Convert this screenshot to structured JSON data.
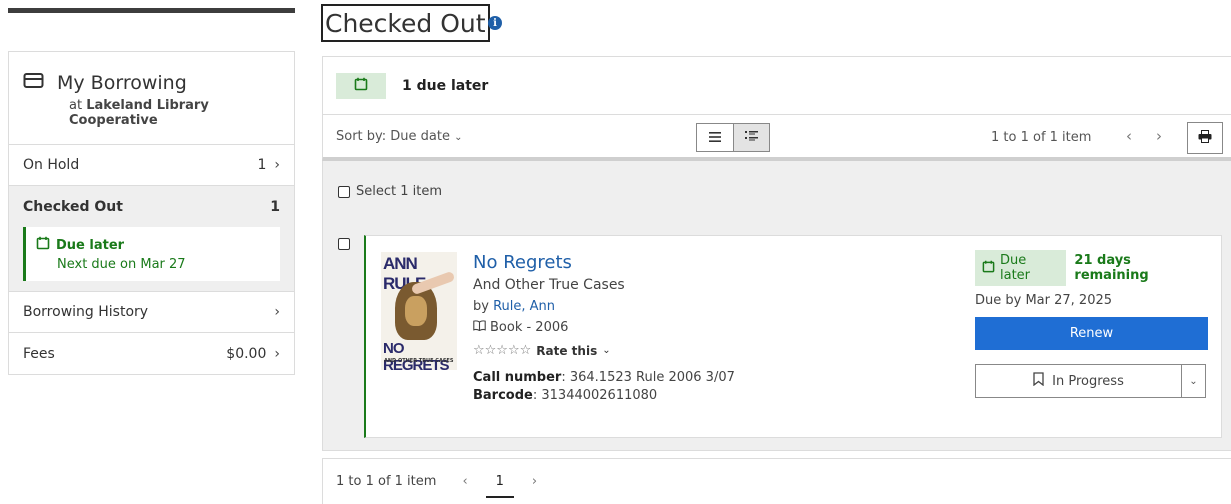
{
  "sidebar": {
    "title": "My Borrowing",
    "at_label": "at",
    "library": "Lakeland Library Cooperative",
    "items": [
      {
        "label": "On Hold",
        "count": "1"
      },
      {
        "label": "Checked Out",
        "count": "1"
      },
      {
        "label": "Borrowing History",
        "count": ""
      },
      {
        "label": "Fees",
        "count": "$0.00"
      }
    ],
    "due_later": {
      "title": "Due later",
      "next": "Next due on Mar 27"
    }
  },
  "page": {
    "title": "Checked Out",
    "info_icon": "i"
  },
  "summary": {
    "due_later_count": "1 due later"
  },
  "toolbar": {
    "sort_label": "Sort by: Due date",
    "range": "1 to 1 of 1 item"
  },
  "list": {
    "select_label": "Select 1 item",
    "items": [
      {
        "title": "No Regrets",
        "subtitle": "And Other True Cases",
        "by": "by",
        "author": "Rule, Ann",
        "format": "Book - 2006",
        "rate_label": "Rate this",
        "call_label": "Call number",
        "call_number": "364.1523 Rule 2006 3/07",
        "barcode_label": "Barcode",
        "barcode": "31344002611080",
        "due_chip": "Due later",
        "remaining": "21 days remaining",
        "due_by": "Due by Mar 27, 2025",
        "renew_label": "Renew",
        "shelf_label": "In Progress",
        "cover": {
          "author_text": "ANN RULE",
          "title_text": "NO REGRETS",
          "sub_text": "AND OTHER TRUE CASES"
        }
      }
    ]
  },
  "footer": {
    "range": "1 to 1 of 1 item",
    "page": "1"
  },
  "colors": {
    "accent_blue": "#1f6ed4",
    "link_blue": "#1f5fa8",
    "due_green": "#1a7a1a",
    "chip_green_bg": "#d9ebd9"
  }
}
